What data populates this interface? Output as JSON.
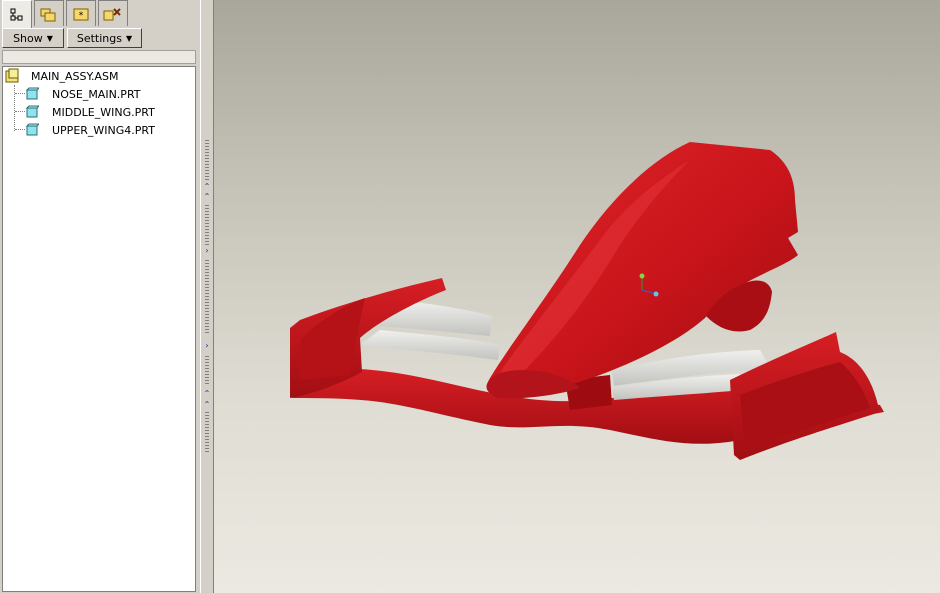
{
  "tabs": [
    {
      "icon": "model-tree-icon",
      "active": true
    },
    {
      "icon": "folder-browser-icon",
      "active": false
    },
    {
      "icon": "favorites-icon",
      "active": false
    },
    {
      "icon": "connections-icon",
      "active": false
    }
  ],
  "toolbar": {
    "show_label": "Show",
    "settings_label": "Settings"
  },
  "tree": {
    "root": {
      "label": "MAIN_ASSY.ASM",
      "icon": "assembly-icon"
    },
    "children": [
      {
        "label": "NOSE_MAIN.PRT",
        "icon": "part-icon"
      },
      {
        "label": "MIDDLE_WING.PRT",
        "icon": "part-icon"
      },
      {
        "label": "UPPER_WING4.PRT",
        "icon": "part-icon"
      }
    ]
  },
  "colors": {
    "model": "#c8141a",
    "wing_element": "#d9d9d6",
    "viewport_top": "#a9a69c",
    "viewport_bottom": "#ebe9e1"
  }
}
